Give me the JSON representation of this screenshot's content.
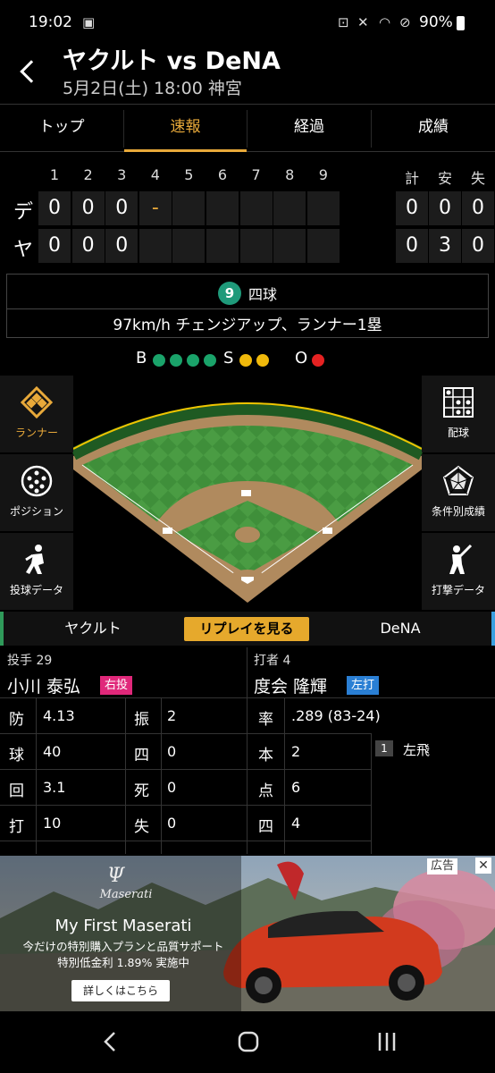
{
  "status": {
    "time": "19:02",
    "battery": "90%"
  },
  "header": {
    "title": "ヤクルト vs DeNA",
    "subtitle": "5月2日(土) 18:00 神宮"
  },
  "tabs": [
    {
      "label": "トップ"
    },
    {
      "label": "速報"
    },
    {
      "label": "経過"
    },
    {
      "label": "成績"
    }
  ],
  "scoreboard": {
    "innings": [
      "1",
      "2",
      "3",
      "4",
      "5",
      "6",
      "7",
      "8",
      "9"
    ],
    "totals_headers": [
      "計",
      "安",
      "失"
    ],
    "rows": [
      {
        "team": "デ",
        "scores": [
          "0",
          "0",
          "0",
          "-",
          "",
          "",
          "",
          "",
          ""
        ],
        "totals": [
          "0",
          "0",
          "0"
        ]
      },
      {
        "team": "ヤ",
        "scores": [
          "0",
          "0",
          "0",
          "",
          "",
          "",
          "",
          "",
          ""
        ],
        "totals": [
          "0",
          "3",
          "0"
        ]
      }
    ]
  },
  "pitch": {
    "number": "9",
    "result": "四球",
    "description": "97km/h チェンジアップ、ランナー1塁"
  },
  "count": {
    "b_label": "B",
    "s_label": "S",
    "o_label": "O",
    "balls": 4,
    "strikes": 2,
    "outs": 1,
    "colors": {
      "ball": "#1aa36a",
      "strike": "#f0b90b",
      "out": "#e52222"
    }
  },
  "side_buttons": {
    "left": [
      {
        "label": "ランナー",
        "icon": "runner-diamond-icon",
        "active": true
      },
      {
        "label": "ポジション",
        "icon": "position-dots-icon"
      },
      {
        "label": "投球データ",
        "icon": "pitcher-icon"
      }
    ],
    "right": [
      {
        "label": "配球",
        "icon": "grid-icon"
      },
      {
        "label": "条件別成績",
        "icon": "radar-icon"
      },
      {
        "label": "打撃データ",
        "icon": "batter-icon"
      }
    ]
  },
  "replay": {
    "home": "ヤクルト",
    "button": "リプレイを見る",
    "away": "DeNA"
  },
  "pitcher": {
    "label": "投手 29",
    "name": "小川 泰弘",
    "hand": "右投"
  },
  "batter": {
    "label": "打者 4",
    "name": "度会 隆輝",
    "hand": "左打"
  },
  "pitcher_stats": [
    {
      "k": "防",
      "v": "4.13",
      "k2": "振",
      "v2": "2"
    },
    {
      "k": "球",
      "v": "40",
      "k2": "四",
      "v2": "0"
    },
    {
      "k": "回",
      "v": "3.1",
      "k2": "死",
      "v2": "0"
    },
    {
      "k": "打",
      "v": "10",
      "k2": "失",
      "v2": "0"
    }
  ],
  "batter_stats": [
    {
      "k": "率",
      "v": ".289 (83-24)"
    },
    {
      "k": "本",
      "v": "2"
    },
    {
      "k": "点",
      "v": "6"
    },
    {
      "k": "四",
      "v": "4"
    }
  ],
  "at_bats": [
    {
      "num": "1",
      "result": "左飛"
    }
  ],
  "ad": {
    "label": "広告",
    "brand": "Maserati",
    "headline": "My First Maserati",
    "line1": "今だけの特別購入プランと品質サポート",
    "line2": "特別低金利 1.89% 実施中",
    "cta": "詳しくはこちら"
  },
  "colors": {
    "accent": "#e8a93a",
    "home_line": "#2f9a5a",
    "away_line": "#3aa0e0"
  }
}
